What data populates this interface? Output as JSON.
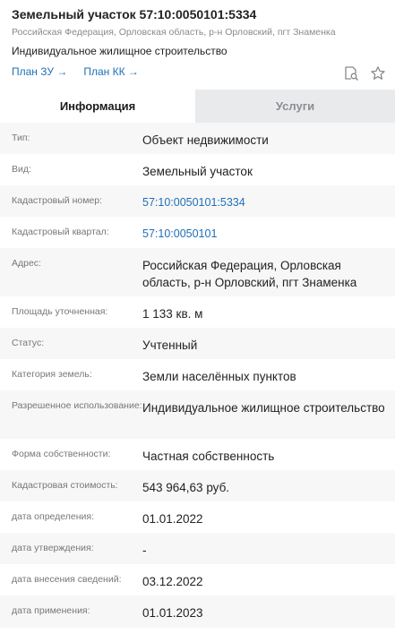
{
  "header": {
    "title": "Земельный участок 57:10:0050101:5334",
    "address": "Российская Федерация, Орловская область, р-н Орловский, пгт Знаменка",
    "purpose": "Индивидуальное жилищное строительство",
    "link_plan_zu": "План ЗУ →",
    "link_plan_kk": "План КК →",
    "icons": [
      "search-document-icon",
      "star-icon"
    ]
  },
  "tabs": {
    "info": "Информация",
    "services": "Услуги"
  },
  "rows": [
    {
      "label": "Тип:",
      "value": "Объект недвижимости"
    },
    {
      "label": "Вид:",
      "value": "Земельный участок"
    },
    {
      "label": "Кадастровый номер:",
      "value": "57:10:0050101:5334"
    },
    {
      "label": "Кадастровый квартал:",
      "value": "57:10:0050101"
    },
    {
      "label": "Адрес:",
      "value": "Российская Федерация, Орловская область, р-н Орловский, пгт Знаменка"
    },
    {
      "label": "Площадь уточненная:",
      "value": "1 133 кв. м"
    },
    {
      "label": "Статус:",
      "value": "Учтенный"
    },
    {
      "label": "Категория земель:",
      "value": "Земли населённых пунктов"
    },
    {
      "label": "Разрешенное использование:",
      "value": "Индивидуальное жилищное строительство"
    },
    {
      "label": "Форма собственности:",
      "value": "Частная собственность"
    },
    {
      "label": "Кадастровая стоимость:",
      "value": "543 964,63 руб."
    },
    {
      "label": "дата определения:",
      "value": "01.01.2022"
    },
    {
      "label": "дата утверждения:",
      "value": "-"
    },
    {
      "label": "дата внесения сведений:",
      "value": "03.12.2022"
    },
    {
      "label": "дата применения:",
      "value": "01.01.2023"
    }
  ]
}
